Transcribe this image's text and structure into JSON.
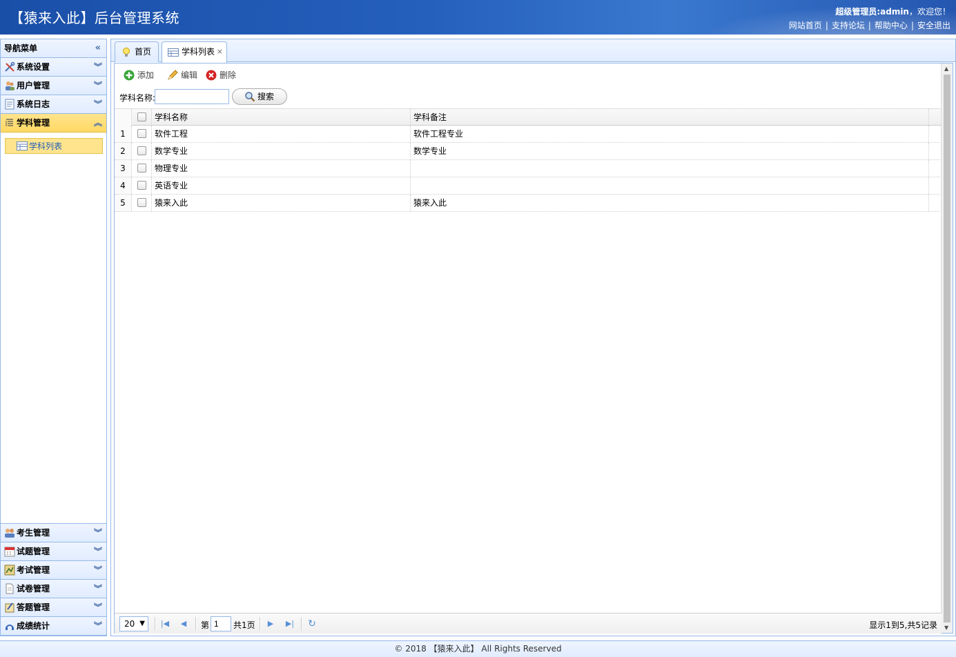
{
  "header": {
    "title": "【猿来入此】后台管理系统",
    "welcome_prefix": "超级管理员:",
    "username": "admin",
    "welcome_suffix": "，欢迎您！",
    "links": [
      "网站首页",
      "支持论坛",
      "帮助中心",
      "安全退出"
    ]
  },
  "nav": {
    "title": "导航菜单",
    "top_panels": [
      {
        "label": "系统设置",
        "icon": "tools-icon"
      },
      {
        "label": "用户管理",
        "icon": "users-icon"
      },
      {
        "label": "系统日志",
        "icon": "log-icon"
      },
      {
        "label": "学科管理",
        "icon": "list-icon",
        "active": true
      }
    ],
    "sub_item": "学科列表",
    "bottom_panels": [
      {
        "label": "考生管理",
        "icon": "students-icon"
      },
      {
        "label": "试题管理",
        "icon": "calendar-icon"
      },
      {
        "label": "考试管理",
        "icon": "exam-icon"
      },
      {
        "label": "试卷管理",
        "icon": "paper-icon"
      },
      {
        "label": "答题管理",
        "icon": "answer-icon"
      },
      {
        "label": "成绩统计",
        "icon": "stats-icon"
      }
    ]
  },
  "tabs": [
    {
      "label": "首页",
      "icon": "bulb-icon"
    },
    {
      "label": "学科列表",
      "icon": "table-icon",
      "selected": true,
      "close": "×"
    }
  ],
  "toolbar": {
    "add": "添加",
    "edit": "编辑",
    "delete": "删除"
  },
  "search": {
    "label": "学科名称:",
    "value": "",
    "button": "搜索"
  },
  "grid": {
    "columns": [
      "学科名称",
      "学科备注"
    ],
    "rows": [
      {
        "num": "1",
        "name": "软件工程",
        "remark": "软件工程专业"
      },
      {
        "num": "2",
        "name": "数学专业",
        "remark": "数学专业"
      },
      {
        "num": "3",
        "name": "物理专业",
        "remark": ""
      },
      {
        "num": "4",
        "name": "英语专业",
        "remark": ""
      },
      {
        "num": "5",
        "name": "猿来入此",
        "remark": "猿来入此"
      }
    ]
  },
  "pager": {
    "page_size": "20",
    "page_prefix": "第",
    "page_value": "1",
    "page_total": "共1页",
    "info": "显示1到5,共5记录"
  },
  "footer": {
    "text": "© 2018 【猿来入此】 All Rights Reserved"
  }
}
